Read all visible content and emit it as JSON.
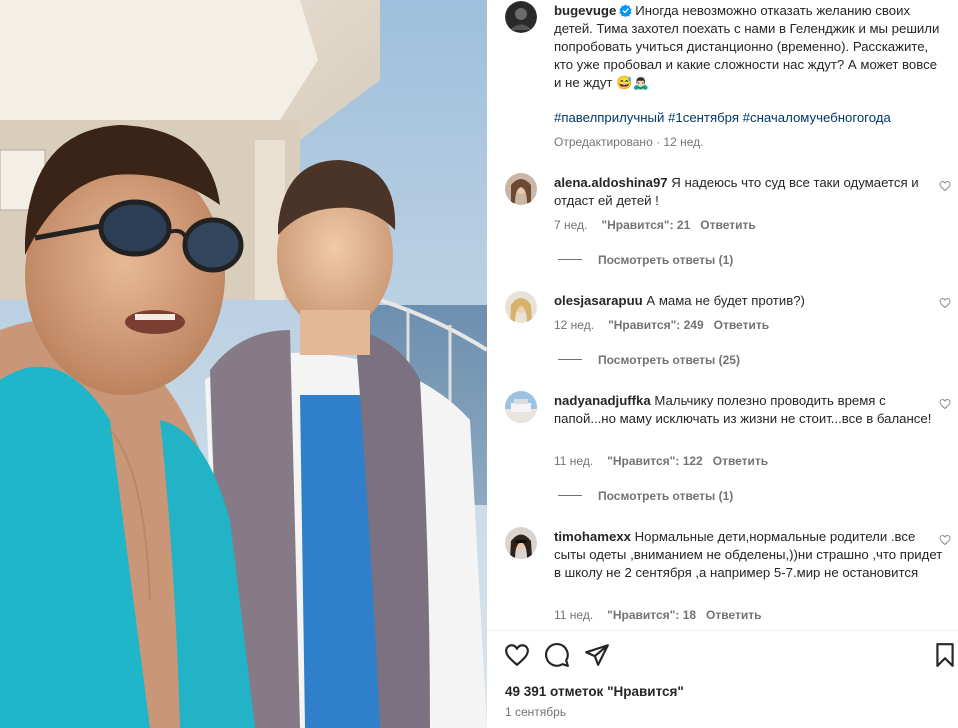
{
  "post": {
    "author": "bugevuge",
    "caption": "Иногда невозможно отказать желанию своих детей. Тима захотел поехать с нами в Геленджик и мы решили попробовать учиться дистанционно (временно). Расскажите, кто уже пробовал и какие сложности нас ждут? А может вовсе и не ждут 😅🙇🏻‍♂",
    "hashtags": "#павелприлучный #1сентября #сначаломучебногогода",
    "edited": "Отредактировано · 12 нед."
  },
  "comments": [
    {
      "user": "alena.aldoshina97",
      "text": "Я надеюсь что суд все таки одумается и отдаст ей детей !",
      "age": "7 нед.",
      "likes": "\"Нравится\": 21",
      "reply": "Ответить",
      "view_replies": "Посмотреть ответы (1)"
    },
    {
      "user": "olesjasarapuu",
      "text": "А мама не будет против?)",
      "age": "12 нед.",
      "likes": "\"Нравится\": 249",
      "reply": "Ответить",
      "view_replies": "Посмотреть ответы (25)"
    },
    {
      "user": "nadyanadjuffka",
      "text": "Мальчику полезно проводить время с папой...но маму исключать из жизни не стоит...все в балансе!",
      "age": "11 нед.",
      "likes": "\"Нравится\": 122",
      "reply": "Ответить",
      "view_replies": "Посмотреть ответы (1)"
    },
    {
      "user": "timohamexx",
      "text": "Нормальные дети,нормальные родители .все сыты одеты ,вниманием не обделены,))ни страшно ,что придет в школу не 2 сентября ,а например 5-7.мир не остановится",
      "age": "11 нед.",
      "likes": "\"Нравится\": 18",
      "reply": "Ответить"
    }
  ],
  "actions": {
    "like_icon": "heart-icon",
    "comment_icon": "comment-icon",
    "share_icon": "share-icon",
    "save_icon": "bookmark-icon"
  },
  "footer": {
    "likes_count": "49 391 отметок \"Нравится\"",
    "date": "1 сентябрь"
  },
  "colors": {
    "text": "#262626",
    "secondary": "#737373",
    "hashtag": "#00376b",
    "verified": "#0095f6"
  }
}
